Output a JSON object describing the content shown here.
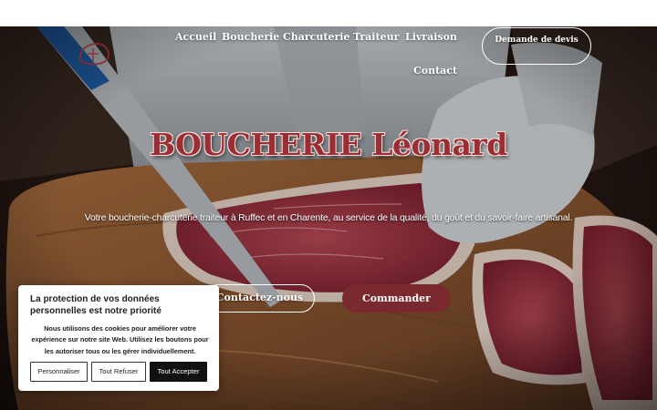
{
  "nav": {
    "items": [
      {
        "label": "Accueil"
      },
      {
        "label": "Boucherie"
      },
      {
        "label": "Charcuterie"
      },
      {
        "label": "Traiteur"
      },
      {
        "label": "Livraison"
      },
      {
        "label": "Contact"
      }
    ],
    "quote_button": "Demande de devis"
  },
  "hero": {
    "title": "BOUCHERIE Léonard",
    "subtitle": "Votre boucherie-charcuterie traiteur à Ruffec et en Charente, au service de la qualité, du goût et du savoir-faire artisanal.",
    "contact_button": "Contactez-nous",
    "order_button": "Commander"
  },
  "cookie_banner": {
    "title": "La protection de vos données personnelles est notre priorité",
    "text": "Nous utilisons des cookies pour améliorer votre expérience sur notre site Web. Utilisez les boutons pour les autoriser tous ou les gérer individuellement.",
    "buttons": {
      "customize": "Personnaliser",
      "refuse_all": "Tout Refuser",
      "accept_all": "Tout Accepter"
    }
  },
  "colors": {
    "brand_red": "#7a2a2f",
    "title_red": "#9b2d35",
    "cookie_primary": "#111111"
  }
}
